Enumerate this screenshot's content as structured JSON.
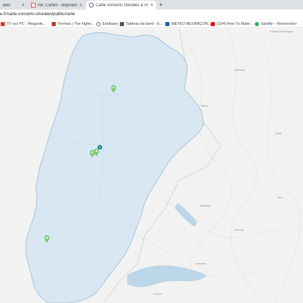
{
  "tabs": [
    {
      "title": "ales",
      "active": false,
      "favicon": "generic-icon"
    },
    {
      "title": "Re: Cartes - stephane.barcon@g",
      "active": false,
      "favicon": "gmail-icon"
    },
    {
      "title": "Carte concerts chorales & Projet",
      "active": true,
      "favicon": "globe-icon"
    }
  ],
  "newtab_label": "+",
  "address": {
    "url": "e.fr/carte-concerts-chorales/public/carte"
  },
  "bookmarks": [
    {
      "label": "TV sur PC : Regarde...",
      "icon": "tv-icon",
      "color": "#e53935"
    },
    {
      "label": "Terrhou | The highe...",
      "icon": "terrhou-icon",
      "color": "#c0392b"
    },
    {
      "label": "Edubase",
      "icon": "edubase-icon",
      "color": "#5f6368"
    },
    {
      "label": "Tableau de bord - E...",
      "icon": "dashboard-icon",
      "color": "#6d4c41"
    },
    {
      "label": "METEO BESANÇON...",
      "icon": "meteo-icon",
      "color": "#1565c0"
    },
    {
      "label": "(104) How To Make...",
      "icon": "youtube-icon",
      "color": "#ff0000"
    },
    {
      "label": "Spotify – Rechercher",
      "icon": "spotify-icon",
      "color": "#1db954"
    }
  ],
  "map": {
    "region_fill": "#d6e6f2",
    "region_stroke": "#8fb8d8",
    "pin_color": "#7dd36b",
    "cluster_color": "#1a8a8a",
    "cluster_count": "2",
    "places": [
      "Mulhouse",
      "Belfort",
      "Bern",
      "Lausanne",
      "Genève",
      "Neuchâtel",
      "Fribourg",
      "Freiburg im Breisgau",
      "Basel"
    ]
  }
}
